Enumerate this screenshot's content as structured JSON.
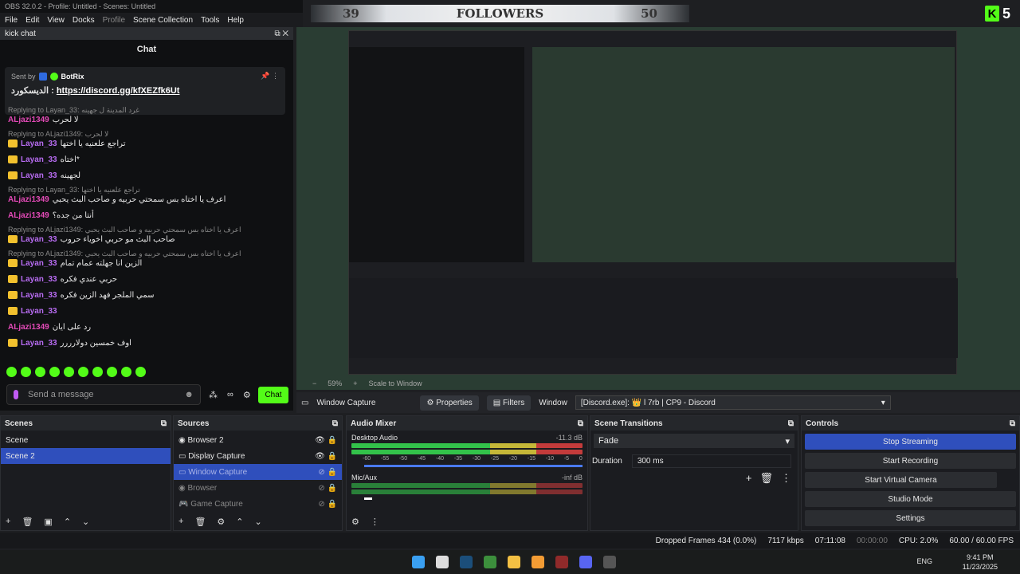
{
  "titlebar": "OBS 32.0.2 - Profile: Untitled - Scenes: Untitled",
  "menu": [
    "File",
    "Edit",
    "View",
    "Docks",
    "Profile",
    "Scene Collection",
    "Tools",
    "Help"
  ],
  "overlay": {
    "left_num": "39",
    "label": "FOLLOWERS",
    "right_num": "50",
    "kick_count": "5",
    "kick_letter": "K"
  },
  "chat_dock": {
    "title": "kick chat",
    "header": "Chat",
    "pinned_sent_by": "Sent by",
    "pinned_user": "BotRix",
    "pinned_prefix": "الديسكورد :",
    "pinned_link": "https://discord.gg/kfXEZfk6Ut",
    "messages": [
      {
        "reply": "Replying to Layan_33: غرد المدينة ل جهينه",
        "user": "ALjazi1349",
        "text": "لا لحرب"
      },
      {
        "reply": "Replying to ALjazi1349: لا لحرب",
        "user": "Layan_33",
        "text": "تراجع علعنيه يا اختها"
      },
      {
        "reply": "",
        "user": "Layan_33",
        "text": "اختاه*"
      },
      {
        "reply": "",
        "user": "Layan_33",
        "text": "لجهينه"
      },
      {
        "reply": "Replying to Layan_33: تراجع علعنيه يا اختها",
        "user": "ALjazi1349",
        "text": "اعرف يا اختاه بس سمحتي حربيه و صاحب البث يحبي"
      },
      {
        "reply": "",
        "user": "ALjazi1349",
        "text": "أنتا من جده؟"
      },
      {
        "reply": "Replying to ALjazi1349: اعرف يا اختاه بس سمحتي حربيه و صاحب البث يحبي",
        "user": "Layan_33",
        "text": "صاحب البث مو حربي اخوياء حروب"
      },
      {
        "reply": "Replying to ALjazi1349: اعرف يا اختاه بس سمحتي حربيه و صاحب البث يحبي",
        "user": "Layan_33",
        "text": "الزين انا جهلته عمام تمام"
      },
      {
        "reply": "",
        "user": "Layan_33",
        "text": "حربي عندي فكره"
      },
      {
        "reply": "",
        "user": "Layan_33",
        "text": "سمي الملجر فهد الزين فكره"
      },
      {
        "reply": "",
        "user": "Layan_33",
        "text": ""
      },
      {
        "reply": "",
        "user": "ALjazi1349",
        "text": "رد على ايان"
      },
      {
        "reply": "",
        "user": "Layan_33",
        "text": "اوف خمسين دولارررر"
      }
    ],
    "input_placeholder": "Send a message",
    "chat_button": "Chat"
  },
  "preview": {
    "zoom": "59%",
    "scale": "Scale to Window"
  },
  "source_toolbar": {
    "source": "Window Capture",
    "properties": "Properties",
    "filters": "Filters",
    "window_label": "Window",
    "window_value": "[Discord.exe]: 👑 l 7rb | CP9 - Discord"
  },
  "scenes": {
    "title": "Scenes",
    "items": [
      "Scene",
      "Scene 2"
    ],
    "selected": 1
  },
  "sources": {
    "title": "Sources",
    "items": [
      "Browser 2",
      "Display Capture",
      "Window Capture",
      "Browser",
      "Game Capture"
    ],
    "selected": 2
  },
  "audio": {
    "title": "Audio Mixer",
    "tracks": [
      {
        "name": "Desktop Audio",
        "db": "-11.3 dB",
        "level": 0.6
      },
      {
        "name": "Mic/Aux",
        "db": "-inf dB",
        "level": 0.0
      }
    ],
    "ticks": [
      "-60",
      "-55",
      "-50",
      "-45",
      "-40",
      "-35",
      "-30",
      "-25",
      "-20",
      "-15",
      "-10",
      "-5",
      "0"
    ]
  },
  "transitions": {
    "title": "Scene Transitions",
    "type": "Fade",
    "duration_label": "Duration",
    "duration_value": "300 ms"
  },
  "controls": {
    "title": "Controls",
    "buttons": [
      "Stop Streaming",
      "Start Recording",
      "Start Virtual Camera",
      "Studio Mode",
      "Settings"
    ]
  },
  "status": {
    "dropped": "Dropped Frames 434 (0.0%)",
    "kbps": "7117 kbps",
    "live_time": "07:11:08",
    "rec_time": "00:00:00",
    "cpu": "CPU: 2.0%",
    "fps": "60.00 / 60.00 FPS"
  },
  "taskbar": {
    "lang": "ENG",
    "time": "9:41 PM",
    "date": "11/23/2025"
  }
}
